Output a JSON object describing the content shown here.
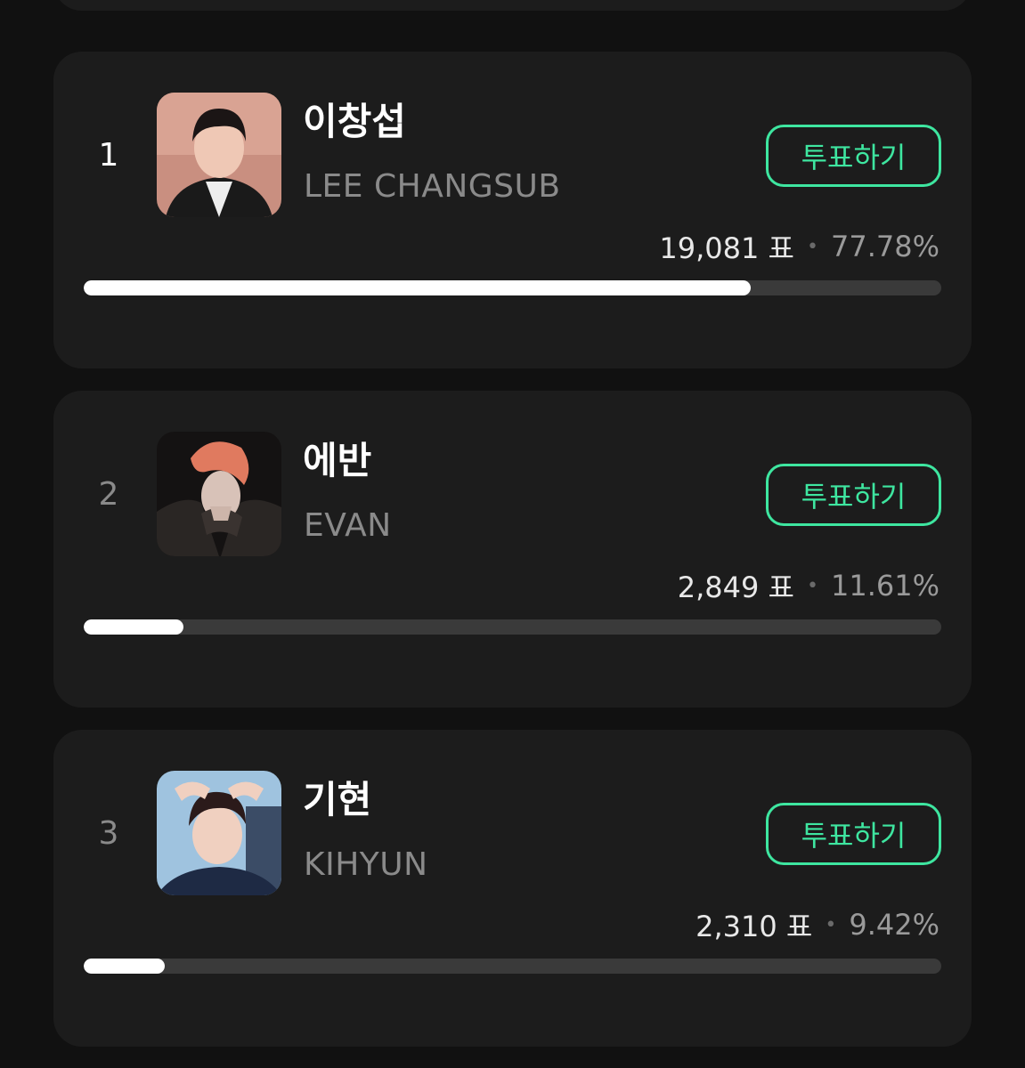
{
  "candidates": [
    {
      "rank": "1",
      "name_ko": "이창섭",
      "name_en": "LEE CHANGSUB",
      "vote_label": "투표하기",
      "votes": "19,081 표",
      "separator": "•",
      "percent": "77.78%",
      "progress": 0.7778,
      "photo": "portrait-photo-red-background"
    },
    {
      "rank": "2",
      "name_ko": "에반",
      "name_en": "EVAN",
      "vote_label": "투표하기",
      "votes": "2,849 표",
      "separator": "•",
      "percent": "11.61%",
      "progress": 0.1161,
      "photo": "portrait-photo-dark-leather"
    },
    {
      "rank": "3",
      "name_ko": "기현",
      "name_en": "KIHYUN",
      "vote_label": "투표하기",
      "votes": "2,310 표",
      "separator": "•",
      "percent": "9.42%",
      "progress": 0.0942,
      "photo": "portrait-photo-blue-background"
    }
  ],
  "colors": {
    "background": "#111111",
    "card": "#1c1c1c",
    "accent": "#3ee6a0",
    "track": "#3a3a3a",
    "fill": "#ffffff"
  }
}
